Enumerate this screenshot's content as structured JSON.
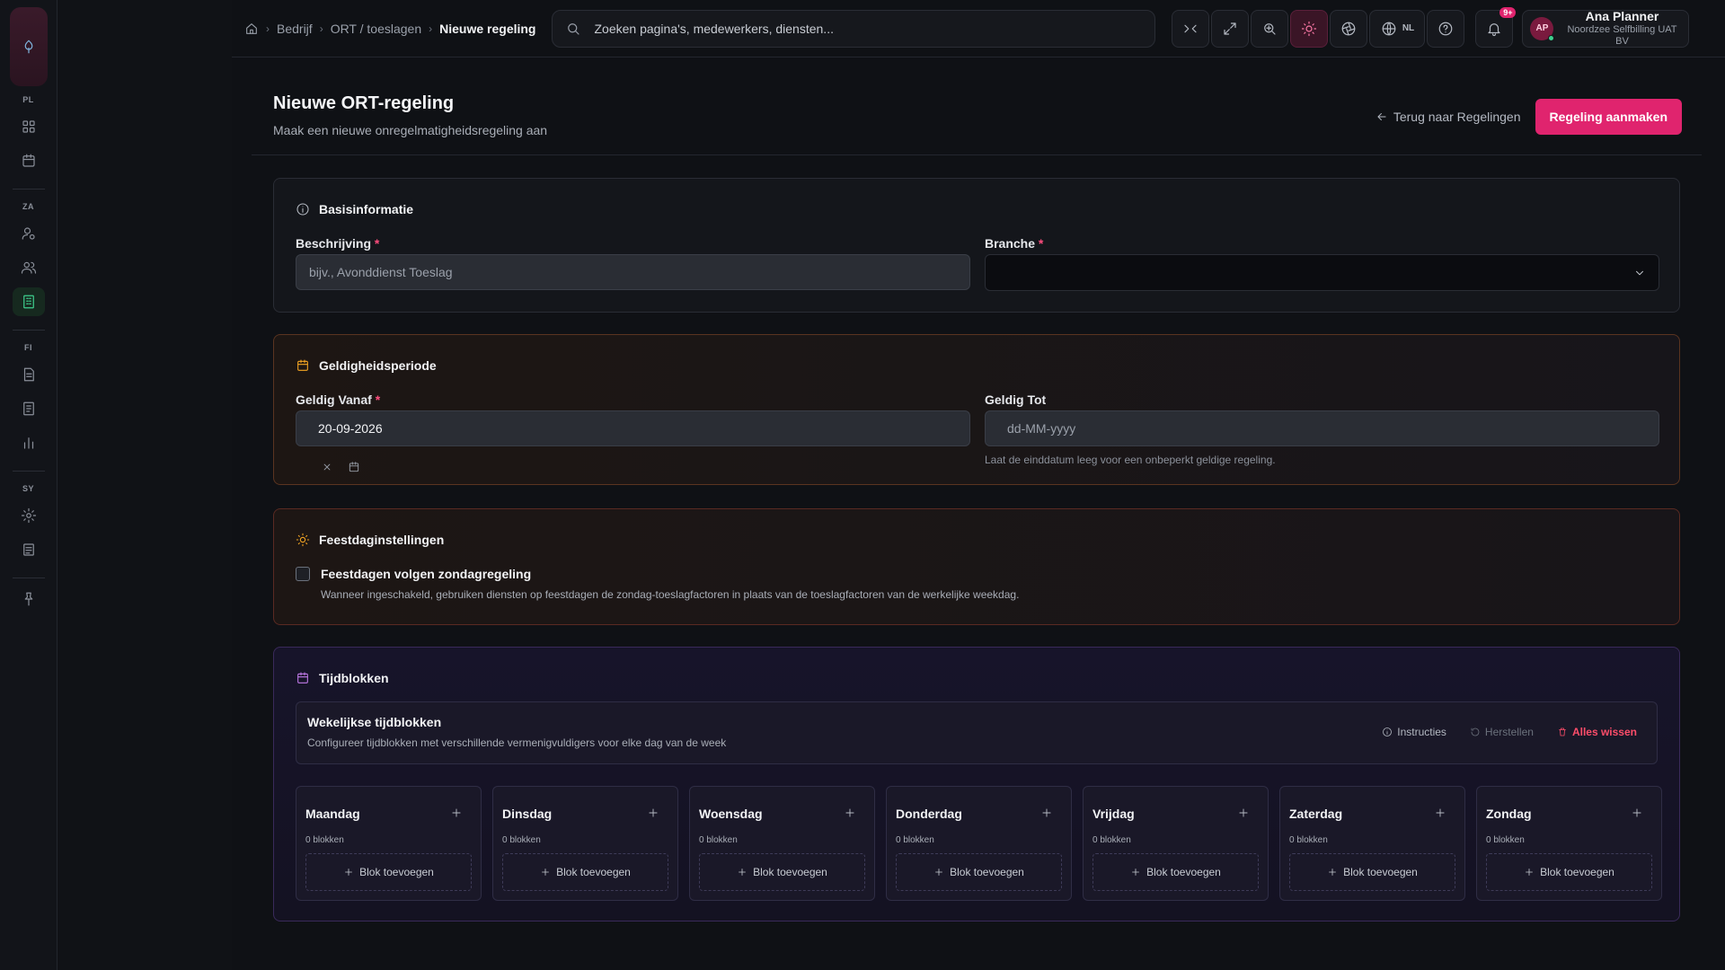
{
  "breadcrumb": {
    "items": [
      "Bedrijf",
      "ORT / toeslagen"
    ],
    "current": "Nieuwe regeling"
  },
  "search": {
    "placeholder": "Zoeken pagina's, medewerkers, diensten..."
  },
  "toolbar": {
    "language": "NL",
    "notifications_badge": "9+"
  },
  "user": {
    "initials": "AP",
    "name": "Ana Planner",
    "org": "Noordzee Selfbilling UAT BV"
  },
  "rail": {
    "groups": [
      {
        "label": "PL",
        "icons": [
          "dashboard-icon",
          "calendar-icon"
        ]
      },
      {
        "label": "ZA",
        "icons": [
          "user-settings-icon",
          "users-icon",
          "building-icon"
        ]
      },
      {
        "label": "FI",
        "icons": [
          "invoice-icon",
          "receipt-icon",
          "chart-icon"
        ]
      },
      {
        "label": "SY",
        "icons": [
          "settings-icon",
          "log-icon"
        ]
      }
    ]
  },
  "page": {
    "title": "Nieuwe ORT-regeling",
    "subtitle": "Maak een nieuwe onregelmatigheidsregeling aan",
    "back_label": "Terug naar Regelingen",
    "create_label": "Regeling aanmaken"
  },
  "basis": {
    "title": "Basisinformatie",
    "description_label": "Beschrijving",
    "description_placeholder": "bijv., Avonddienst Toeslag",
    "branche_label": "Branche",
    "branche_value": ""
  },
  "period": {
    "title": "Geldigheidsperiode",
    "from_label": "Geldig Vanaf",
    "from_value": "20-09-2026",
    "to_label": "Geldig Tot",
    "to_placeholder": "dd-MM-yyyy",
    "to_hint": "Laat de einddatum leeg voor een onbeperkt geldige regeling."
  },
  "holiday": {
    "title": "Feestdaginstellingen",
    "checkbox_label": "Feestdagen volgen zondagregeling",
    "checkbox_checked": false,
    "description": "Wanneer ingeschakeld, gebruiken diensten op feestdagen de zondag-toeslagfactoren in plaats van de toeslagfactoren van de werkelijke weekdag."
  },
  "blocks": {
    "title": "Tijdblokken",
    "weekly_title": "Wekelijkse tijdblokken",
    "weekly_sub": "Configureer tijdblokken met verschillende vermenigvuldigers voor elke dag van de week",
    "instructions": "Instructies",
    "reset": "Herstellen",
    "clear_all": "Alles wissen",
    "add_label": "Blok toevoegen",
    "days": [
      {
        "name": "Maandag",
        "count": "0 blokken"
      },
      {
        "name": "Dinsdag",
        "count": "0 blokken"
      },
      {
        "name": "Woensdag",
        "count": "0 blokken"
      },
      {
        "name": "Donderdag",
        "count": "0 blokken"
      },
      {
        "name": "Vrijdag",
        "count": "0 blokken"
      },
      {
        "name": "Zaterdag",
        "count": "0 blokken"
      },
      {
        "name": "Zondag",
        "count": "0 blokken"
      }
    ]
  },
  "colors": {
    "accent": "#e0246e",
    "success": "#3ecf8e",
    "danger": "#ff4d6a"
  }
}
